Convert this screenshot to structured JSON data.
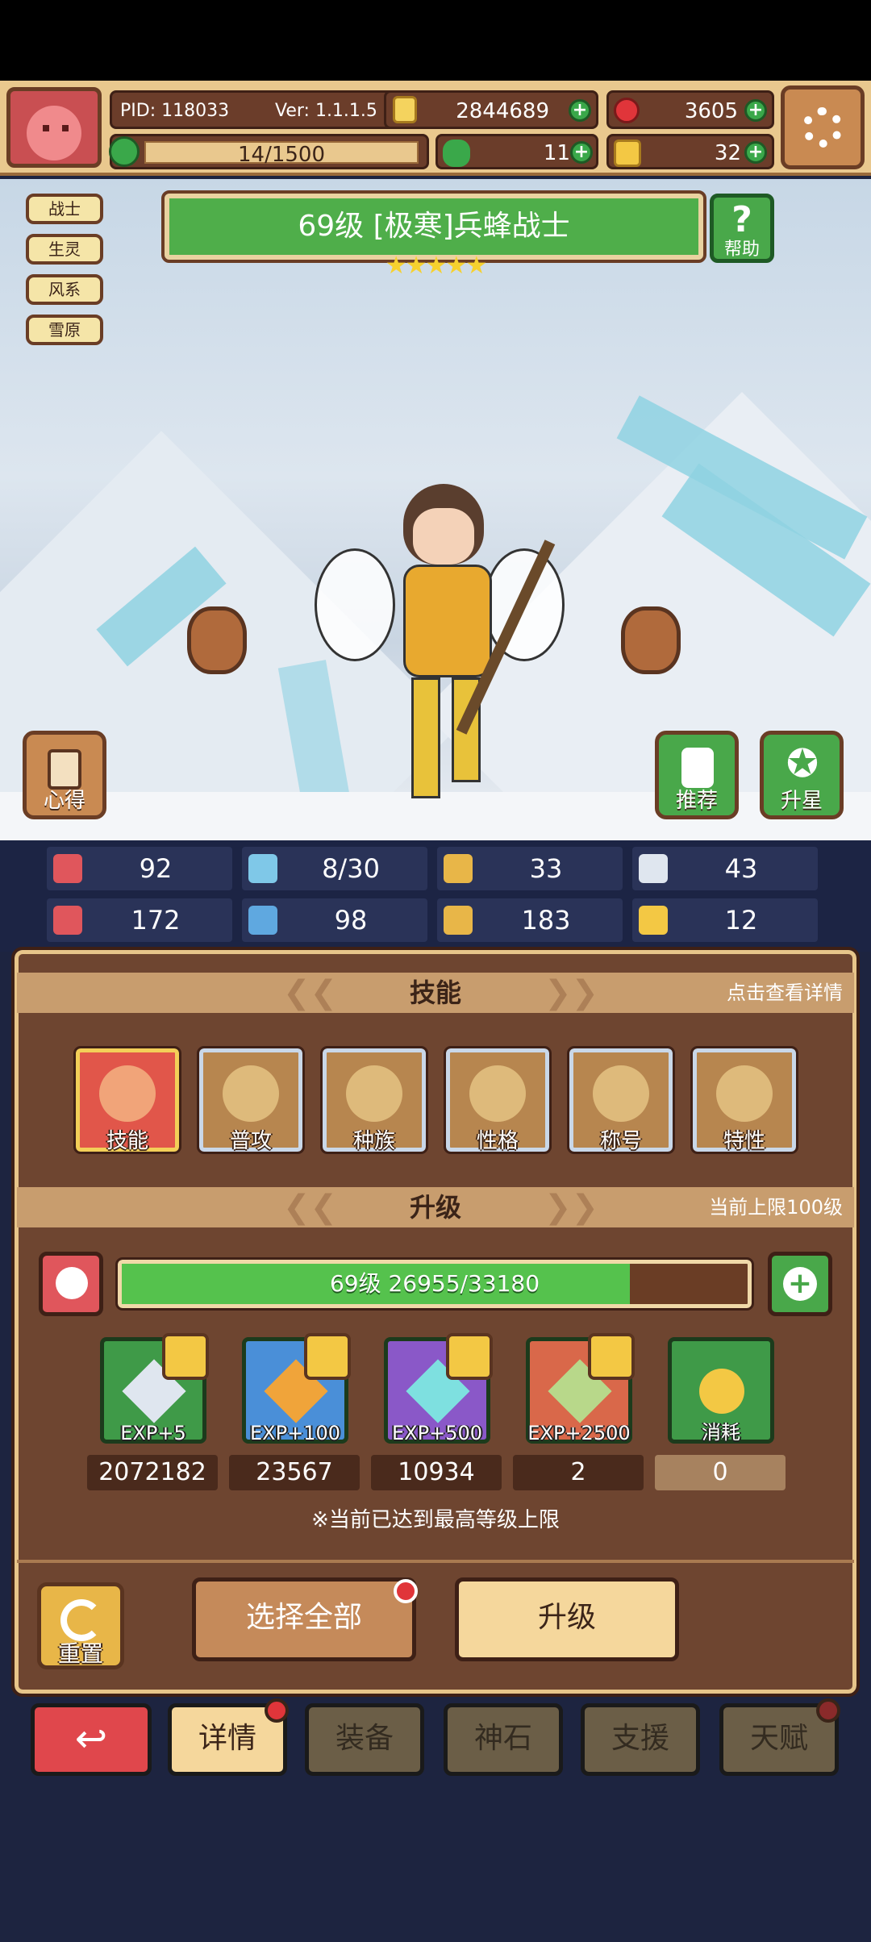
{
  "header": {
    "pid": "PID: 118033",
    "version": "Ver: 1.1.1.5",
    "gold": "2844689",
    "gems": "3605",
    "energy": "14/1500",
    "clover": "11",
    "keys": "32"
  },
  "tags": [
    "战士",
    "生灵",
    "风系",
    "雪原"
  ],
  "title": "69级  [极寒]兵蜂战士",
  "stars": "★★★★★",
  "help_label": "帮助",
  "left_button": "心得",
  "right_buttons": [
    "推荐",
    "升星"
  ],
  "stats": [
    {
      "icon": "heart-icon",
      "value": "92",
      "color": "#e0565c"
    },
    {
      "icon": "water-drop-icon",
      "value": "8/30",
      "color": "#7fc8e8"
    },
    {
      "icon": "shield-icon",
      "value": "33",
      "color": "#e8b648"
    },
    {
      "icon": "wing-icon",
      "value": "43",
      "color": "#dfe6ef"
    },
    {
      "icon": "fist-icon",
      "value": "172",
      "color": "#e0565c"
    },
    {
      "icon": "book-icon",
      "value": "98",
      "color": "#5fa8e0"
    },
    {
      "icon": "armor-icon",
      "value": "183",
      "color": "#e8b648"
    },
    {
      "icon": "magnet-icon",
      "value": "12",
      "color": "#f3c844"
    }
  ],
  "skills_section": {
    "title": "技能",
    "right": "点击查看详情"
  },
  "skills": [
    "技能",
    "普攻",
    "种族",
    "性格",
    "称号",
    "特性"
  ],
  "upgrade_section": {
    "title": "升级",
    "right": "当前上限100级"
  },
  "xp": {
    "text": "69级  26955/33180",
    "fraction": 0.8124
  },
  "items": [
    {
      "label": "EXP+5",
      "count": "2072182",
      "color": "#3f9a48",
      "gem": "#dfe6ef"
    },
    {
      "label": "EXP+100",
      "count": "23567",
      "color": "#4a8fd8",
      "gem": "#f0a43a"
    },
    {
      "label": "EXP+500",
      "count": "10934",
      "color": "#8a58c8",
      "gem": "#7ee0e0"
    },
    {
      "label": "EXP+2500",
      "count": "2",
      "color": "#d9684a",
      "gem": "#b8d88a"
    },
    {
      "label": "消耗",
      "count": "0",
      "color": "#3f9a48",
      "gem": "#f3c844"
    }
  ],
  "note": "※当前已达到最高等级上限",
  "reset_label": "重置",
  "select_all": "选择全部",
  "upgrade_btn": "升级",
  "tabs": [
    "详情",
    "装备",
    "神石",
    "支援",
    "天赋"
  ]
}
